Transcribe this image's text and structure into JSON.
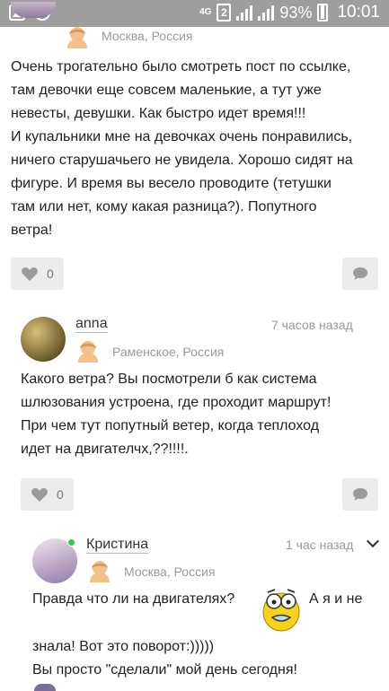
{
  "status_bar": {
    "network": "4G",
    "sim": "2",
    "battery": "93%",
    "time": "10:01"
  },
  "comments": [
    {
      "city": "Москва, Россия",
      "text": [
        "Очень трогательно было смотреть пост по ссылке,",
        "там девочки еще совсем маленькие, а тут уже",
        "невесты, девушки. Как быстро идет время!!!",
        "И купальники мне на девочках очень понравились,",
        "ничего старушачьего не увидела. Хорошо сидят на",
        "фигуре. И время вы весело проводите (тетушки",
        "там или нет, кому какая разница?). Попутного",
        "ветра!"
      ],
      "likes": "0"
    },
    {
      "author": "anna",
      "time": "7 часов назад",
      "city": "Раменское, Россия",
      "text": [
        "Какого ветра? Вы посмотрели б как система",
        "шлюзования устроена, где проходит маршрут!",
        "При чем тут попутный ветер, когда теплоход",
        "идет на двигателчх,??!!!!."
      ],
      "likes": "0"
    },
    {
      "author": "Кристина",
      "time": "1 час назад",
      "city": "Москва, Россия",
      "text_a": "Правда что ли на двигателях?",
      "text_b": "А я и не",
      "text_c": "знала! Вот это поворот:)))))",
      "text_d": "Вы просто \"сделали\" мой день сегодня!"
    }
  ]
}
